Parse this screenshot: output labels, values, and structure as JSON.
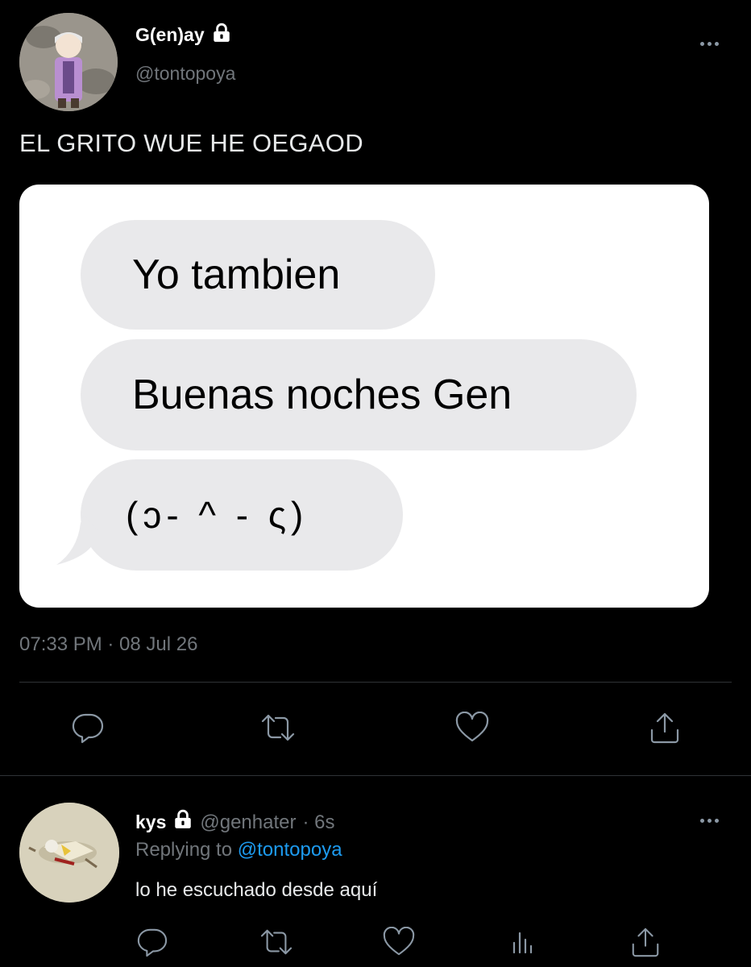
{
  "tweet": {
    "author_name": "G(en)ay",
    "author_handle": "@tontopoya",
    "text": "EL GRITO WUE HE OEGAOD",
    "timestamp": "07:33 PM · 08 Jul 26",
    "image": {
      "bubbles": [
        "Yo tambien",
        "Buenas noches Gen",
        "(ↄ- ^ - ς)"
      ]
    },
    "actions": [
      "reply-icon",
      "retweet-icon",
      "like-icon",
      "share-icon"
    ]
  },
  "reply": {
    "author_name": "kys",
    "author_handle": "@genhater",
    "age": "· 6s",
    "replying_prefix": "Replying to",
    "replying_to": "@tontopoya",
    "text": "lo he escuchado desde aquí",
    "actions": [
      "reply-icon",
      "retweet-icon",
      "like-icon",
      "analytics-icon",
      "share-icon"
    ]
  },
  "colors": {
    "background": "#000000",
    "link": "#1d9bf0",
    "muted": "#71767b",
    "bubble": "#e9e9eb"
  }
}
